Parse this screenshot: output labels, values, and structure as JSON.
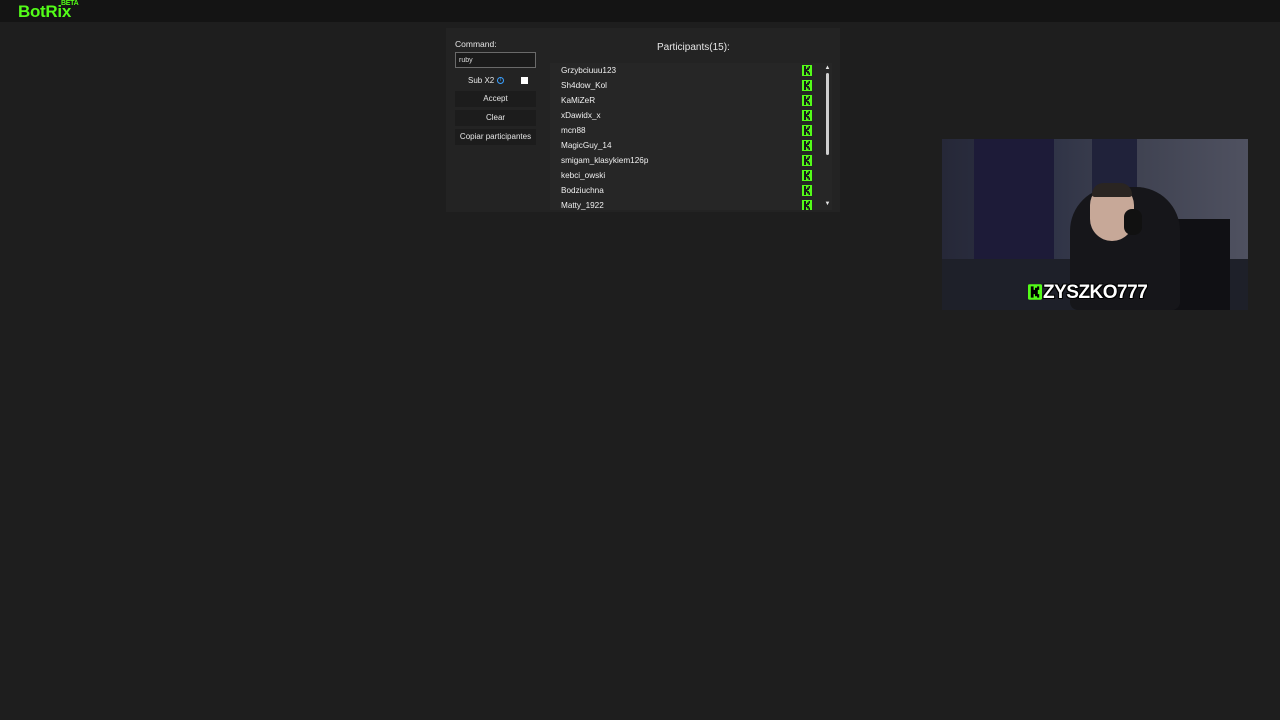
{
  "app": {
    "logo": "BotRix",
    "badge": "BETA"
  },
  "panel": {
    "command_label": "Command:",
    "command_value": "ruby",
    "sub_label": "Sub X2",
    "sub_checked": true,
    "buttons": {
      "accept": "Accept",
      "clear": "Clear",
      "copy": "Copiar participantes"
    },
    "participants_title": "Participants(15):",
    "participants": [
      "Grzybciuuu123",
      "Sh4dow_Kol",
      "KaMiZeR",
      "xDawidx_x",
      "mcn88",
      "MagicGuy_14",
      "smigam_klasykiem126p",
      "kebci_owski",
      "Bodziuchna",
      "Matty_1922"
    ]
  },
  "webcam": {
    "overlay_name": "ZYSZKO777"
  },
  "colors": {
    "brand": "#53fc18",
    "background": "#1e1e1e",
    "panel": "#232323"
  },
  "icons": {
    "platform": "kick-icon",
    "info": "info-icon"
  }
}
